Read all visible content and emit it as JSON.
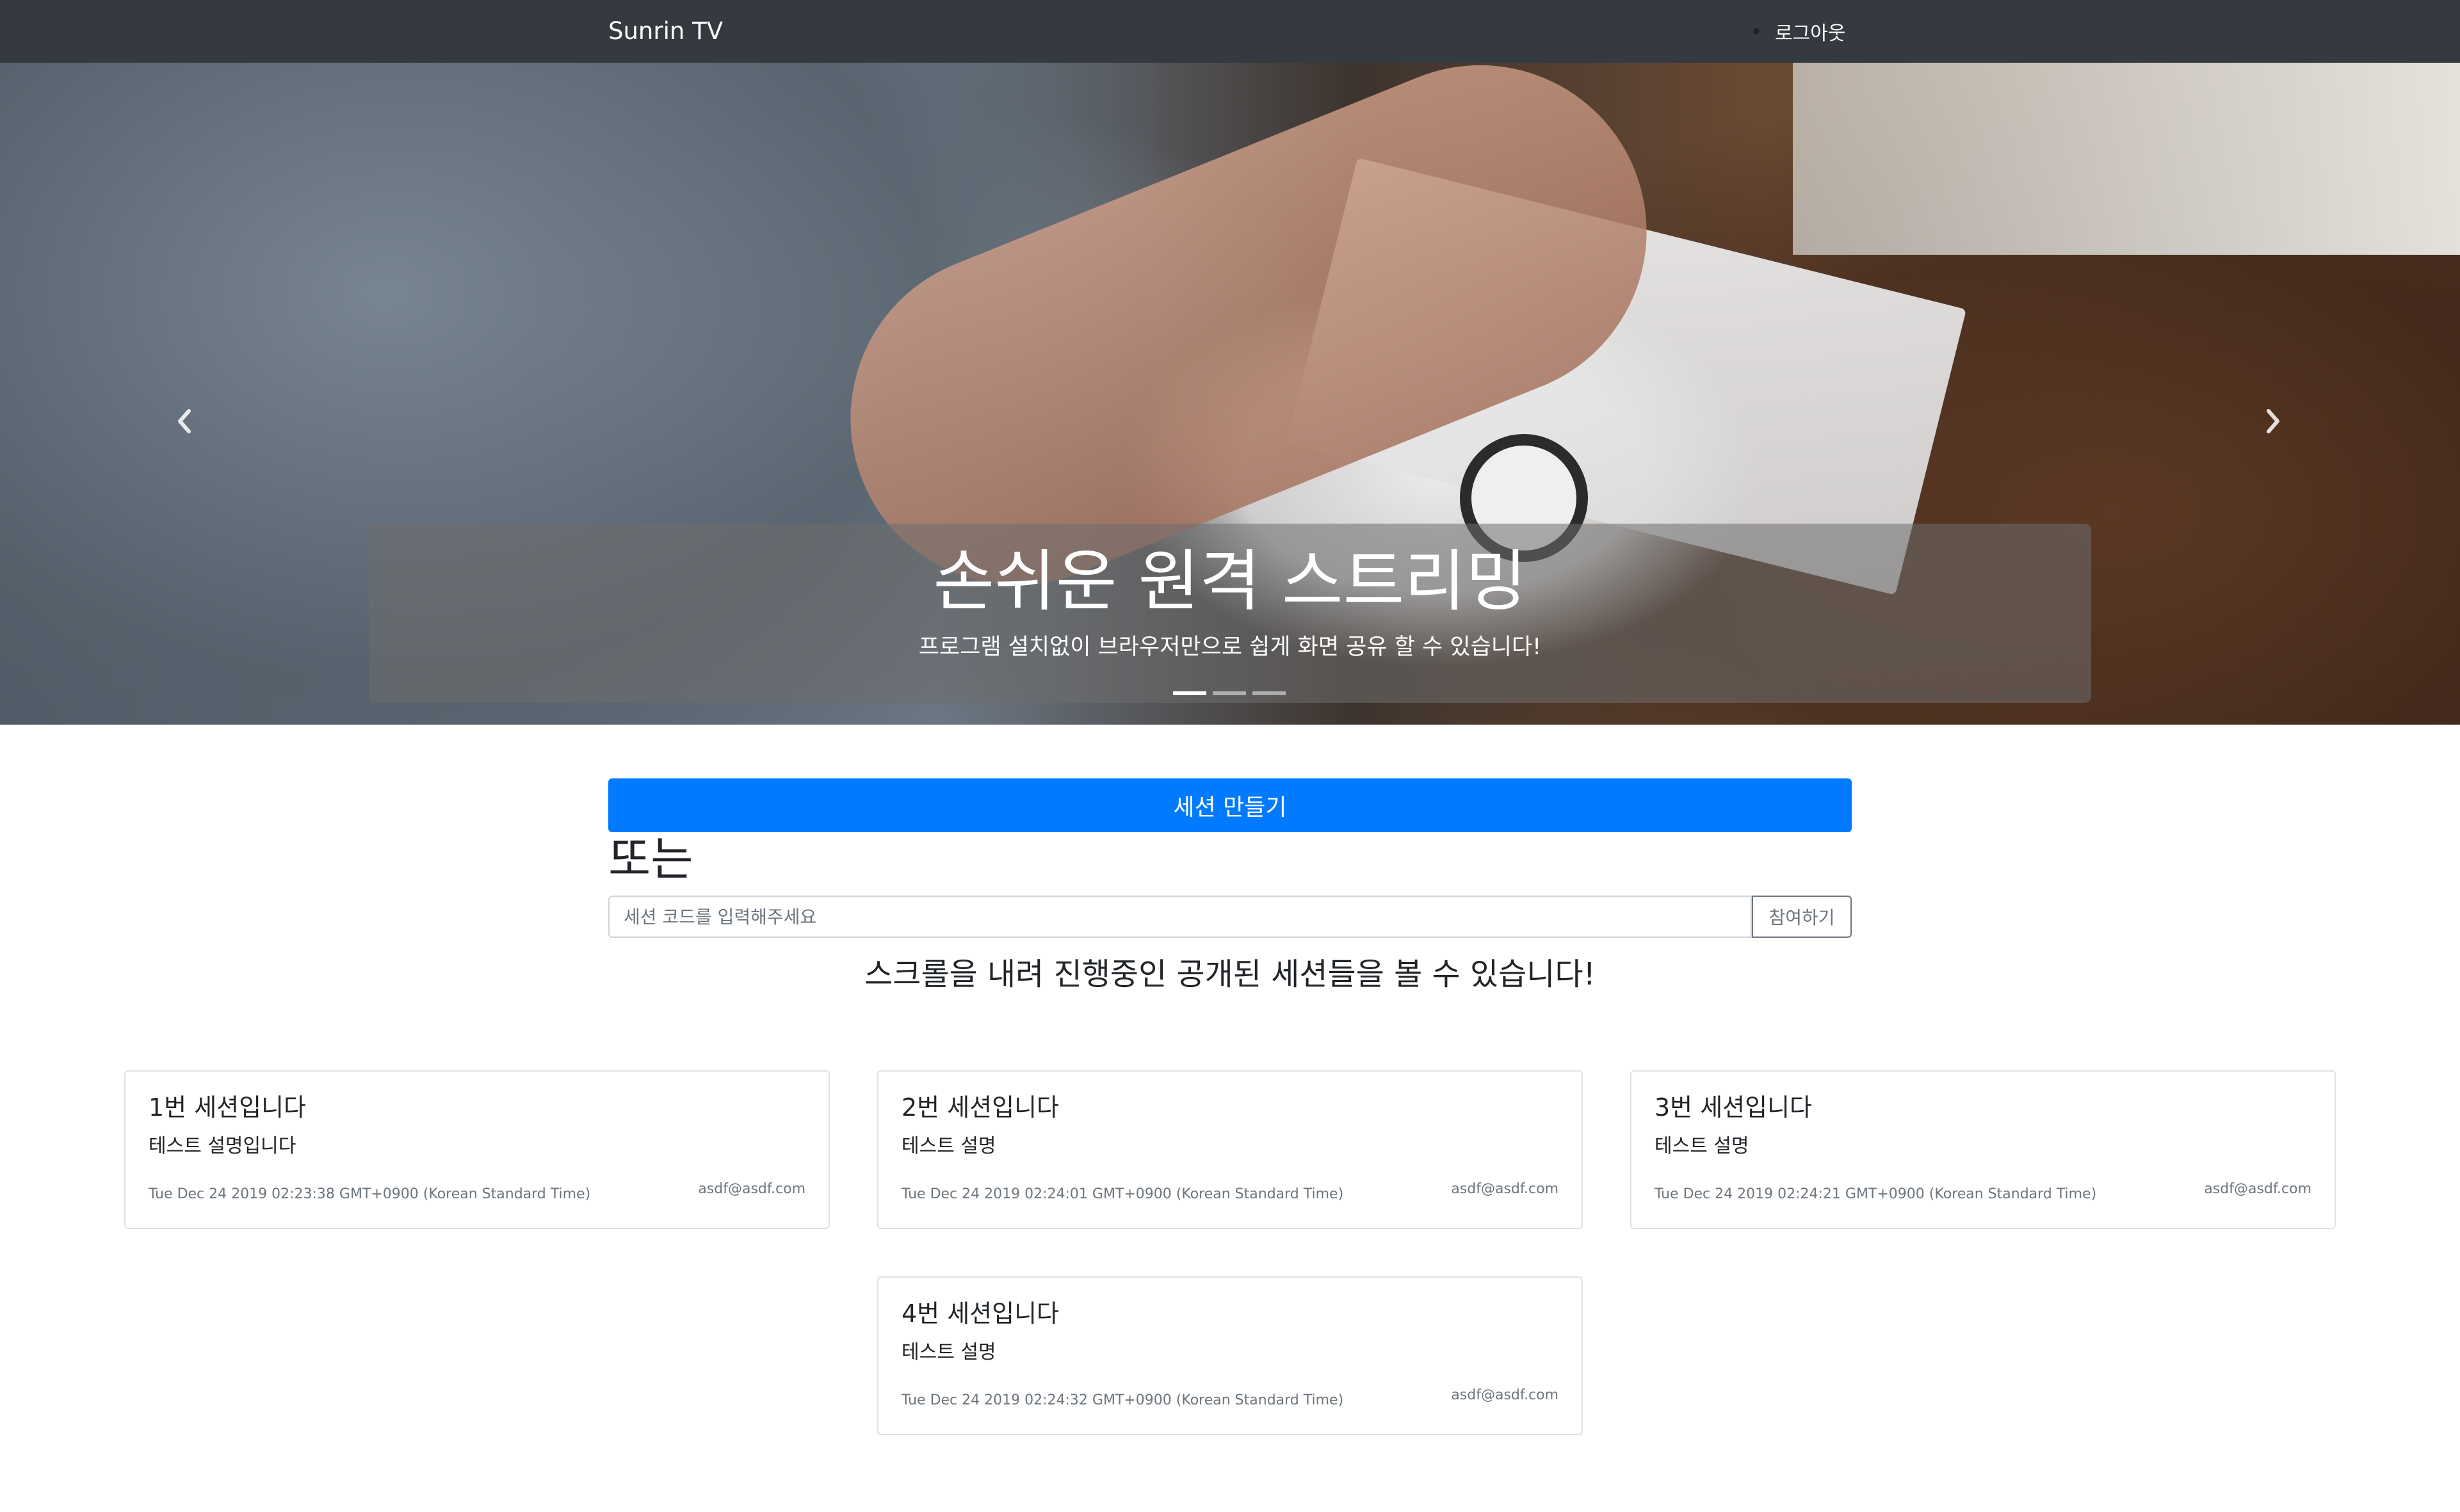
{
  "navbar": {
    "brand": "Sunrin TV",
    "logout_label": "로그아웃"
  },
  "carousel": {
    "title": "손쉬운 원격 스트리밍",
    "subtitle": "프로그램 설치없이 브라우저만으로 쉽게 화면 공유 할 수 있습니다!",
    "prev_icon": "chevron-left-icon",
    "next_icon": "chevron-right-icon",
    "slide_count": 3,
    "active_slide": 1
  },
  "main": {
    "create_session_label": "세션 만들기",
    "or_label": "또는",
    "join_placeholder": "세션 코드를 입력해주세요",
    "join_value": "",
    "join_button_label": "참여하기",
    "scroll_hint": "스크롤을 내려 진행중인 공개된 세션들을 볼 수 있습니다!"
  },
  "sessions": [
    {
      "title": "1번 세션입니다",
      "description": "테스트 설명입니다",
      "created_at": "Tue Dec 24 2019 02:23:38 GMT+0900 (Korean Standard Time)",
      "owner": "asdf@asdf.com"
    },
    {
      "title": "2번 세션입니다",
      "description": "테스트 설명",
      "created_at": "Tue Dec 24 2019 02:24:01 GMT+0900 (Korean Standard Time)",
      "owner": "asdf@asdf.com"
    },
    {
      "title": "3번 세션입니다",
      "description": "테스트 설명",
      "created_at": "Tue Dec 24 2019 02:24:21 GMT+0900 (Korean Standard Time)",
      "owner": "asdf@asdf.com"
    },
    {
      "title": "4번 세션입니다",
      "description": "테스트 설명",
      "created_at": "Tue Dec 24 2019 02:24:32 GMT+0900 (Korean Standard Time)",
      "owner": "asdf@asdf.com"
    }
  ],
  "colors": {
    "navbar_bg": "#343a40",
    "primary": "#007bff",
    "secondary": "#6c757d"
  }
}
